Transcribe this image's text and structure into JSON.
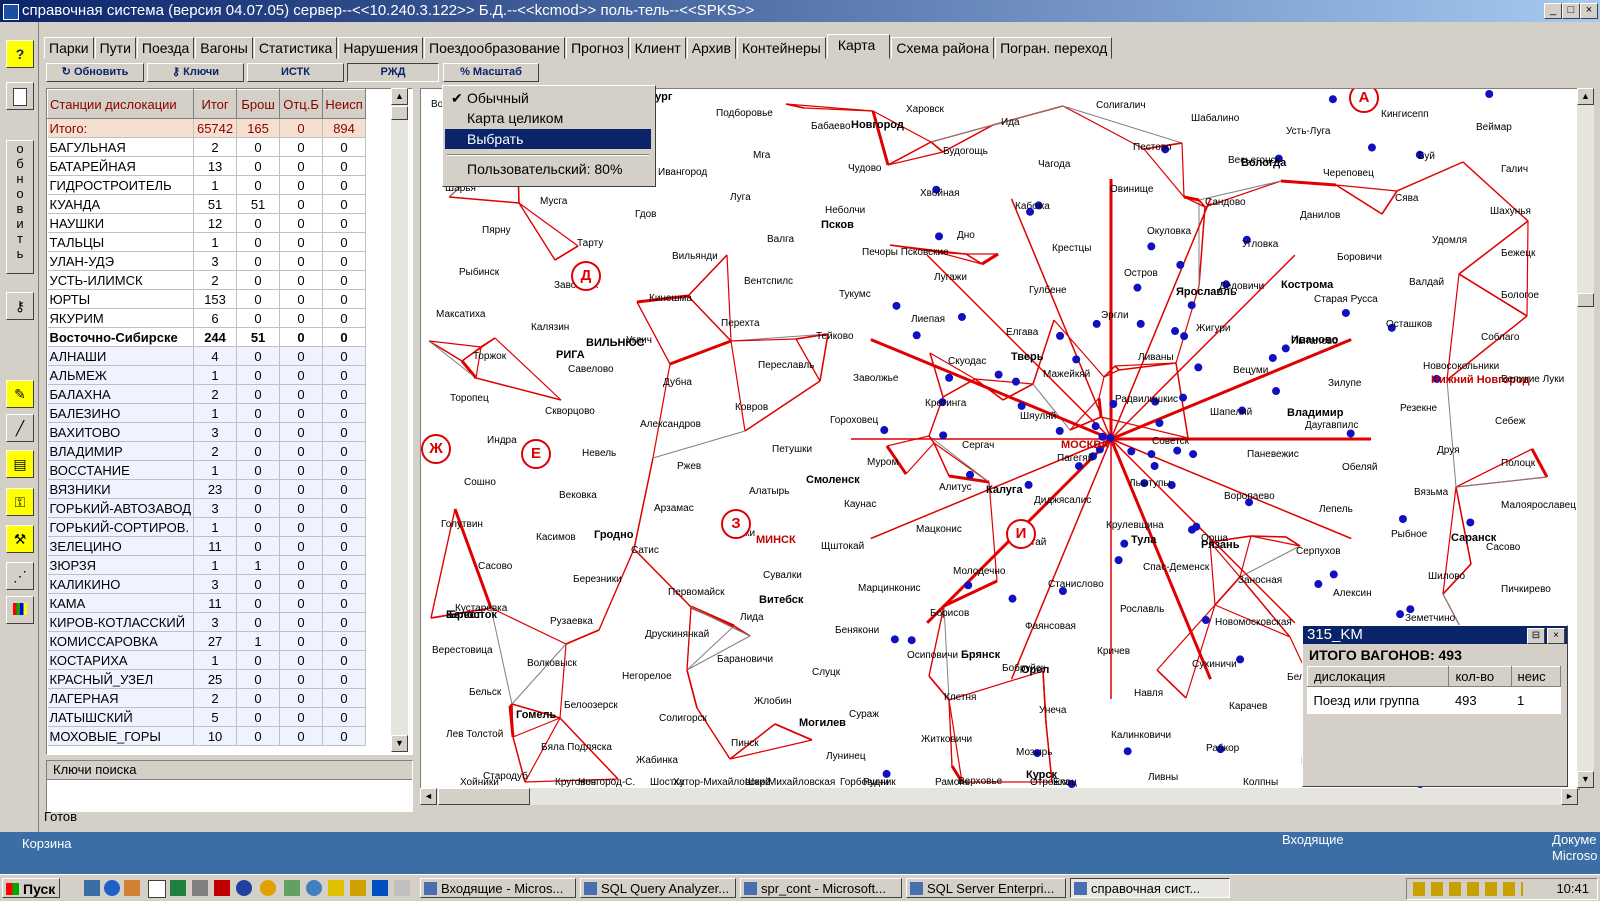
{
  "window": {
    "title": "справочная система (версия 04.07.05) сервер--<<10.240.3.122>> Б.Д.--<<kcmod>> поль-тель--<<SPKS>>",
    "min": "_",
    "max": "□",
    "close": "×"
  },
  "vtoolbar": {
    "help": "?",
    "refresh_letters": [
      "о",
      "б",
      "н",
      "о",
      "в",
      "и",
      "т",
      "ь"
    ]
  },
  "tabs": [
    "Парки",
    "Пути",
    "Поезда",
    "Вагоны",
    "Статистика",
    "Нарушения",
    "Поездообразование",
    "Прогноз",
    "Клиент",
    "Архив",
    "Контейнеры",
    "Карта",
    "Схема района",
    "Погран. переход"
  ],
  "active_tab": "Карта",
  "toolbar": {
    "refresh": "Обновить",
    "keys": "Ключи",
    "istk": "ИСТК",
    "rzhd": "РЖД",
    "scale": "Масштаб"
  },
  "scale_menu": {
    "items": [
      "Обычный",
      "Карта целиком",
      "Выбрать",
      "Пользовательский: 80%"
    ],
    "checked": "✔",
    "selected_index": 2
  },
  "grid": {
    "headers": [
      "Станции дислокации",
      "Итог",
      "Брош",
      "Отц.Б",
      "Неисп"
    ],
    "total": [
      "Итого:",
      "65742",
      "165",
      "0",
      "894"
    ],
    "rows": [
      [
        "БАГУЛЬНАЯ",
        "2",
        "0",
        "0",
        "0"
      ],
      [
        "БАТАРЕЙНАЯ",
        "13",
        "0",
        "0",
        "0"
      ],
      [
        "ГИДРОСТРОИТЕЛЬ",
        "1",
        "0",
        "0",
        "0"
      ],
      [
        "КУАНДА",
        "51",
        "51",
        "0",
        "0"
      ],
      [
        "НАУШКИ",
        "12",
        "0",
        "0",
        "0"
      ],
      [
        "ТАЛЬЦЫ",
        "1",
        "0",
        "0",
        "0"
      ],
      [
        "УЛАН-УДЭ",
        "3",
        "0",
        "0",
        "0"
      ],
      [
        "УСТЬ-ИЛИМСК",
        "2",
        "0",
        "0",
        "0"
      ],
      [
        "ЮРТЫ",
        "153",
        "0",
        "0",
        "0"
      ],
      [
        "ЯКУРИМ",
        "6",
        "0",
        "0",
        "0"
      ]
    ],
    "region": [
      "Восточно-Сибирске",
      "244",
      "51",
      "0",
      "0"
    ],
    "rows2": [
      [
        "АЛНАШИ",
        "4",
        "0",
        "0",
        "0"
      ],
      [
        "АЛЬМЕЖ",
        "1",
        "0",
        "0",
        "0"
      ],
      [
        "БАЛАХНА",
        "2",
        "0",
        "0",
        "0"
      ],
      [
        "БАЛЕЗИНО",
        "1",
        "0",
        "0",
        "0"
      ],
      [
        "ВАХИТОВО",
        "3",
        "0",
        "0",
        "0"
      ],
      [
        "ВЛАДИМИР",
        "2",
        "0",
        "0",
        "0"
      ],
      [
        "ВОССТАНИЕ",
        "1",
        "0",
        "0",
        "0"
      ],
      [
        "ВЯЗНИКИ",
        "23",
        "0",
        "0",
        "0"
      ],
      [
        "ГОРЬКИЙ-АВТОЗАВОД",
        "3",
        "0",
        "0",
        "0"
      ],
      [
        "ГОРЬКИЙ-СОРТИРОВ.",
        "1",
        "0",
        "0",
        "0"
      ],
      [
        "ЗЕЛЕЦИНО",
        "11",
        "0",
        "0",
        "0"
      ],
      [
        "ЗЮРЗЯ",
        "1",
        "1",
        "0",
        "0"
      ],
      [
        "КАЛИКИНО",
        "3",
        "0",
        "0",
        "0"
      ],
      [
        "КАМА",
        "11",
        "0",
        "0",
        "0"
      ],
      [
        "КИРОВ-КОТЛАССКИЙ",
        "3",
        "0",
        "0",
        "0"
      ],
      [
        "КОМИССАРОВКА",
        "27",
        "1",
        "0",
        "0"
      ],
      [
        "КОСТАРИХА",
        "1",
        "0",
        "0",
        "0"
      ],
      [
        "КРАСНЫЙ_УЗЕЛ",
        "25",
        "0",
        "0",
        "0"
      ],
      [
        "ЛАГЕРНАЯ",
        "2",
        "0",
        "0",
        "0"
      ],
      [
        "ЛАТЫШСКИЙ",
        "5",
        "0",
        "0",
        "0"
      ],
      [
        "МОХОВЫЕ_ГОРЫ",
        "10",
        "0",
        "0",
        "0"
      ]
    ]
  },
  "keys_header": "Ключи поиска",
  "status": "Готов",
  "popup": {
    "title": "315_KM",
    "summary": "ИТОГО ВАГОНОВ: 493",
    "headers": [
      "дислокация",
      "кол-во",
      "неис"
    ],
    "row": [
      "Поезд или группа",
      "493",
      "1"
    ]
  },
  "map": {
    "zones": [
      "Д",
      "Е",
      "Ж",
      "З",
      "И",
      "А"
    ],
    "cities_bold": [
      "Санкт-Петербург",
      "Новгород",
      "Псков",
      "РИГА",
      "ВИЛЬНЮС",
      "МИНСК",
      "Гродно",
      "Брест",
      "Гомель",
      "Могилев",
      "Витебск",
      "Смоленск",
      "Калуга",
      "Тверь",
      "МОСКВА",
      "Ярославль",
      "Кострома",
      "Иваново",
      "Владимир",
      "Тула",
      "Рязань",
      "Брянск",
      "Орел",
      "Курск",
      "Белосток",
      "Нижний Новгород",
      "Вологда",
      "Саранск"
    ],
    "cities": [
      "Волховстрой",
      "Кириши",
      "Тихвин",
      "Подборовье",
      "Бабаево",
      "Харовск",
      "Ида",
      "Солигалич",
      "Шабалино",
      "Усть-Луга",
      "Кингисепп",
      "Веймар",
      "Нарва",
      "Тапа",
      "Ивангород",
      "Мга",
      "Чудово",
      "Будогощь",
      "Чагода",
      "Пестово",
      "Весьегонск",
      "Череповец",
      "Буй",
      "Галич",
      "Шарья",
      "Мусга",
      "Гдов",
      "Луга",
      "Неболчи",
      "Хвойная",
      "Кабожа",
      "Овинище",
      "Сандово",
      "Данилов",
      "Сява",
      "Шахунья",
      "Пярну",
      "Тарту",
      "Вильянди",
      "Валга",
      "Печоры Псковские",
      "Дно",
      "Крестцы",
      "Окуловка",
      "Угловка",
      "Боровичи",
      "Удомля",
      "Бежецк",
      "Рыбинск",
      "Заволжск",
      "Кинешма",
      "Вентспилс",
      "Тукумс",
      "Лугажи",
      "Гулбене",
      "Остров",
      "Дедовичи",
      "Старая Русса",
      "Валдай",
      "Бологое",
      "Максатиха",
      "Калязин",
      "Углич",
      "Перехта",
      "Тейково",
      "Лиепая",
      "Елгава",
      "Эргли",
      "Жигури",
      "Пыталово",
      "Осташков",
      "Соблаго",
      "Торжок",
      "Савелово",
      "Дубна",
      "Переславль",
      "Заволжье",
      "Скуодас",
      "Мажейкяй",
      "Ливаны",
      "Вецуми",
      "Зилупе",
      "Новосокольники",
      "Великие Луки",
      "Торопец",
      "Скворцово",
      "Александров",
      "Ковров",
      "Гороховец",
      "Кретинга",
      "Шяуляй",
      "Радвилишкис",
      "Шапеляй",
      "Даугавпилс",
      "Резекне",
      "Себеж",
      "Индра",
      "Невель",
      "Ржев",
      "Петушки",
      "Муром",
      "Сергач",
      "Пагегяй",
      "Советск",
      "Паневежис",
      "Обеляй",
      "Друя",
      "Полоцк",
      "Сошно",
      "Вековка",
      "Арзамас",
      "Алатырь",
      "Каунас",
      "Алитус",
      "Диджясалис",
      "Лынтупы",
      "Воропаево",
      "Лепель",
      "Вязьма",
      "Малоярославец",
      "Голутвин",
      "Касимов",
      "Сатис",
      "Шатки",
      "Щштокай",
      "Мацконис",
      "Гудогай",
      "Крулевщина",
      "Орша",
      "Серпухов",
      "Рыбное",
      "Сасово",
      "Сасово",
      "Березники",
      "Первомайск",
      "Сувалки",
      "Марцинконис",
      "Молодечно",
      "Станислово",
      "Спас-Деменск",
      "Заносная",
      "Алексин",
      "Шилово",
      "Пичкирево",
      "Кустаревка",
      "Рузаевка",
      "Друскинянкай",
      "Лида",
      "Бенякони",
      "Борисов",
      "Фаянсовая",
      "Рославль",
      "Новомосковская",
      "Ряжск",
      "Земетчино",
      "Свислочь",
      "Верестовица",
      "Волковыск",
      "Негорелое",
      "Барановичи",
      "Слуцк",
      "Осиповичи",
      "Бобруйск",
      "Кричев",
      "Сухиничи",
      "Белев",
      "Скуратово",
      "Мичуринск",
      "Бельск",
      "Белоозерск",
      "Солигорск",
      "Жлобин",
      "Сураж",
      "Клетня",
      "Унеча",
      "Навля",
      "Карачев",
      "Дудорово",
      "Волово",
      "Ефремов",
      "Лев Толстой",
      "Бяла Подляска",
      "Жабинка",
      "Пинск",
      "Лунинец",
      "Житковичи",
      "Мозырь",
      "Калинковичи",
      "Рабкор",
      "Новозыбков",
      "Клинцы",
      "Климов",
      "Стародуб",
      "Новгород-С.",
      "Хутор-Михайловский",
      "Михайловская",
      "Рудник",
      "Верховье",
      "Елец",
      "Ливны",
      "Колпны",
      "Мармыжи",
      "Влодава",
      "Камень-Каш.",
      "Хойники",
      "Круговеч",
      "Шостка",
      "Шорс",
      "Горбовичи",
      "Рамонь",
      "Отрожка"
    ]
  },
  "desktop": {
    "trash": "Корзина",
    "inbox": "Входящие",
    "docs": "Докуме",
    "ms": "Microsо"
  },
  "taskbar": {
    "start": "Пуск",
    "tasks": [
      "Входящие - Micros...",
      "SQL Query Analyzer...",
      "spr_cont - Microsoft...",
      "SQL Server Enterpri...",
      "справочная сист..."
    ],
    "active_index": 4,
    "clock": "10:41"
  }
}
